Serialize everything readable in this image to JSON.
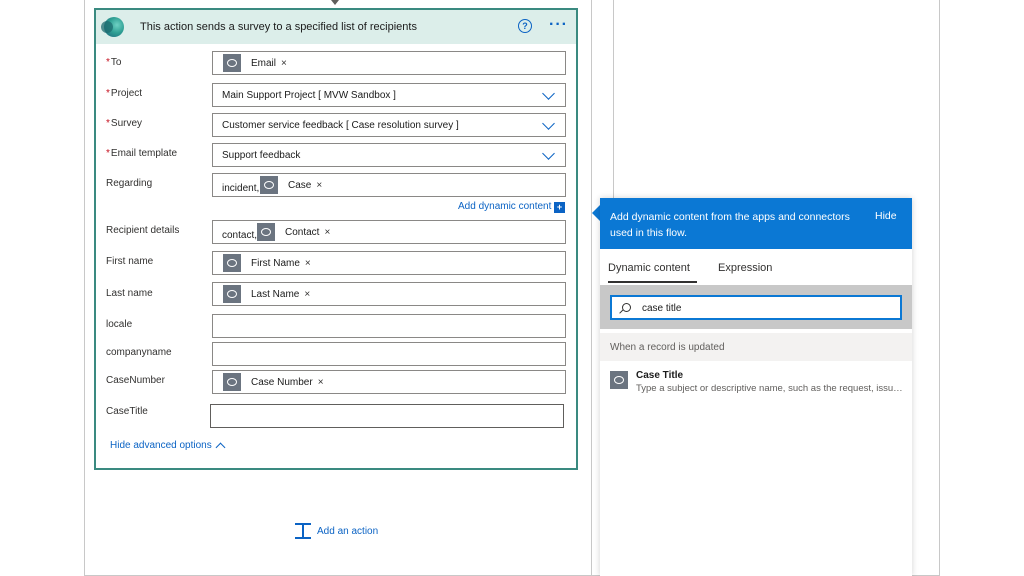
{
  "card": {
    "title": "This action sends a survey to a specified list of recipients",
    "help_glyph": "?",
    "more_glyph": "···",
    "fields": {
      "to": {
        "label": "To",
        "required": "*",
        "token": "Email"
      },
      "project": {
        "label": "Project",
        "required": "*",
        "value": "Main Support Project [ MVW Sandbox ]"
      },
      "survey": {
        "label": "Survey",
        "required": "*",
        "value": "Customer service feedback [ Case resolution survey ]"
      },
      "email_template": {
        "label": "Email template",
        "required": "*",
        "value": "Support feedback"
      },
      "regarding": {
        "label": "Regarding",
        "prefix": "incident,",
        "token": "Case"
      },
      "recipient_details": {
        "label": "Recipient details",
        "prefix": "contact,",
        "token": "Contact"
      },
      "first_name": {
        "label": "First name",
        "token": "First Name"
      },
      "last_name": {
        "label": "Last name",
        "token": "Last Name"
      },
      "locale": {
        "label": "locale",
        "value": ""
      },
      "companyname": {
        "label": "companyname",
        "value": ""
      },
      "casenumber": {
        "label": "CaseNumber",
        "token": "Case Number"
      },
      "casetitle": {
        "label": "CaseTitle",
        "value": ""
      }
    },
    "token_remove_glyph": "×",
    "add_dynamic_content": "Add dynamic content",
    "add_dynamic_glyph": "+",
    "hide_advanced": "Hide advanced options"
  },
  "add_action": {
    "label": "Add an action"
  },
  "panel": {
    "header_text": "Add dynamic content from the apps and connectors used in this flow.",
    "hide_label": "Hide",
    "tabs": {
      "dynamic": "Dynamic content",
      "expression": "Expression"
    },
    "search": {
      "value": "case title",
      "placeholder": ""
    },
    "section_label": "When a record is updated",
    "results": [
      {
        "title": "Case Title",
        "description": "Type a subject or descriptive name, such as the request, issue, or company name, to identify the case."
      }
    ]
  },
  "colors": {
    "accent": "#0b78d4",
    "link": "#0b63c4",
    "card_border": "#3a8a80",
    "card_header": "#dceeea",
    "required": "#c50f1f",
    "token_icon": "#6b7480"
  }
}
